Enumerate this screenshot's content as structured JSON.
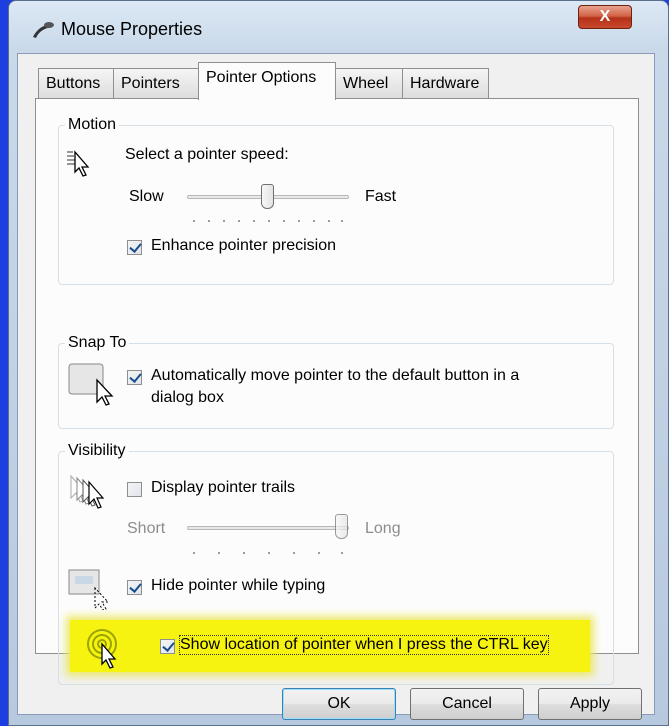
{
  "window": {
    "title": "Mouse Properties",
    "close_label": "X"
  },
  "tabs": [
    {
      "label": "Buttons"
    },
    {
      "label": "Pointers"
    },
    {
      "label": "Pointer Options"
    },
    {
      "label": "Wheel"
    },
    {
      "label": "Hardware"
    }
  ],
  "motion": {
    "legend": "Motion",
    "speed_label": "Select a pointer speed:",
    "slow": "Slow",
    "fast": "Fast",
    "speed_value": 0.5,
    "enhance_label": "Enhance pointer precision",
    "enhance_checked": true
  },
  "snap": {
    "legend": "Snap To",
    "auto_label_line1": "Automatically move pointer to the default button in a",
    "auto_label_line2": "dialog box",
    "auto_checked": true
  },
  "visibility": {
    "legend": "Visibility",
    "trails_label": "Display pointer trails",
    "trails_checked": false,
    "short": "Short",
    "long": "Long",
    "trails_value": 1.0,
    "hide_label": "Hide pointer while typing",
    "hide_checked": true,
    "ctrl_label": "Show location of pointer when I press the CTRL key",
    "ctrl_checked": true
  },
  "buttons": {
    "ok": "OK",
    "cancel": "Cancel",
    "apply": "Apply"
  },
  "colors": {
    "highlight": "#f7f310",
    "desktop": "#1d3fe0"
  }
}
